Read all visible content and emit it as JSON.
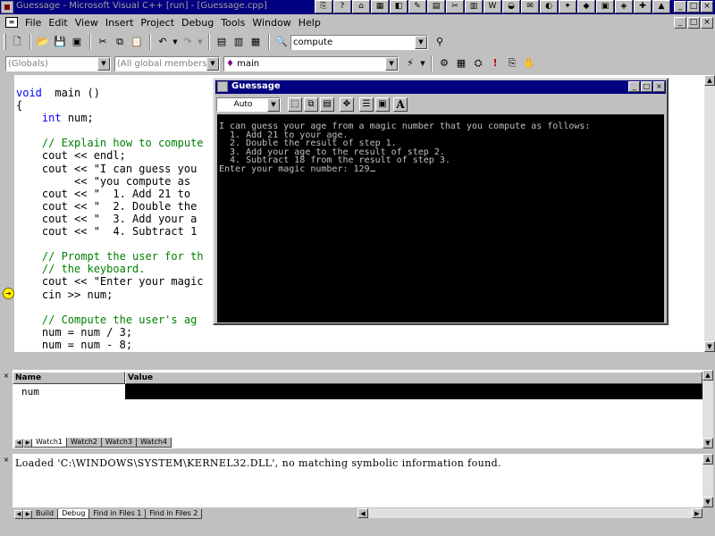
{
  "window": {
    "title": "Guessage - Microsoft Visual C++ [run] - [Guessage.cpp]",
    "min": "_",
    "max": "□",
    "close": "×"
  },
  "taskbar_icons": [
    "⎘",
    "?",
    "⌂",
    "▦",
    "◧",
    "✎",
    "▤",
    "✂",
    "▥",
    "W",
    "◒",
    "✉",
    "◐",
    "✦",
    "◆",
    "▣",
    "◈",
    "✚",
    "▲"
  ],
  "menu": [
    "File",
    "Edit",
    "View",
    "Insert",
    "Project",
    "Debug",
    "Tools",
    "Window",
    "Help"
  ],
  "toolbar1": {
    "find_combo": "compute"
  },
  "toolbar2": {
    "class_combo": "(Globals)",
    "members_combo": "(All global members)",
    "function_combo": "main"
  },
  "code_lines": [
    {
      "t": [
        [
          "kw",
          "void"
        ],
        [
          "",
          "  main ()"
        ]
      ]
    },
    {
      "t": [
        [
          "",
          "{"
        ]
      ]
    },
    {
      "t": [
        [
          "",
          "    "
        ],
        [
          "kw",
          "int"
        ],
        [
          "",
          " num;"
        ]
      ]
    },
    {
      "t": [
        [
          "",
          ""
        ]
      ]
    },
    {
      "t": [
        [
          "",
          "    "
        ],
        [
          "cm",
          "// Explain how to compute"
        ]
      ]
    },
    {
      "t": [
        [
          "",
          "    cout << endl;"
        ]
      ]
    },
    {
      "t": [
        [
          "",
          "    cout << \"I can guess you"
        ]
      ]
    },
    {
      "t": [
        [
          "",
          "         << \"you compute as"
        ]
      ]
    },
    {
      "t": [
        [
          "",
          "    cout << \"  1. Add 21 to "
        ]
      ]
    },
    {
      "t": [
        [
          "",
          "    cout << \"  2. Double the"
        ]
      ]
    },
    {
      "t": [
        [
          "",
          "    cout << \"  3. Add your a"
        ]
      ]
    },
    {
      "t": [
        [
          "",
          "    cout << \"  4. Subtract 1"
        ]
      ]
    },
    {
      "t": [
        [
          "",
          ""
        ]
      ]
    },
    {
      "t": [
        [
          "",
          "    "
        ],
        [
          "cm",
          "// Prompt the user for th"
        ]
      ]
    },
    {
      "t": [
        [
          "",
          "    "
        ],
        [
          "cm",
          "// the keyboard."
        ]
      ]
    },
    {
      "t": [
        [
          "",
          "    cout << \"Enter your magic"
        ]
      ]
    },
    {
      "t": [
        [
          "",
          "    cin >> num;"
        ]
      ]
    },
    {
      "t": [
        [
          "",
          ""
        ]
      ]
    },
    {
      "t": [
        [
          "",
          "    "
        ],
        [
          "cm",
          "// Compute the user's ag"
        ]
      ]
    },
    {
      "t": [
        [
          "",
          "    num = num / 3;"
        ]
      ]
    },
    {
      "t": [
        [
          "",
          "    num = num - 8;"
        ]
      ]
    }
  ],
  "console": {
    "title": "Guessage",
    "font_combo": "Auto",
    "lines": [
      "I can guess your age from a magic number that you compute as follows:",
      "  1. Add 21 to your age.",
      "  2. Double the result of step 1.",
      "  3. Add your age to the result of step 2.",
      "  4. Subtract 18 from the result of step 3.",
      "Enter your magic number: 129"
    ]
  },
  "watch": {
    "col_name": "Name",
    "col_value": "Value",
    "rows": [
      {
        "name": "num",
        "value": ""
      }
    ],
    "tabs": [
      "Watch1",
      "Watch2",
      "Watch3",
      "Watch4"
    ]
  },
  "output": {
    "text": "Loaded 'C:\\WINDOWS\\SYSTEM\\KERNEL32.DLL', no matching symbolic information found.",
    "tabs": [
      "Build",
      "Debug",
      "Find in Files 1",
      "Find in Files 2"
    ]
  },
  "colors": {
    "title_bar": "#000080",
    "keyword": "#0000ff",
    "comment": "#008000",
    "console_bg": "#000000",
    "console_fg": "#c0c0c0"
  }
}
